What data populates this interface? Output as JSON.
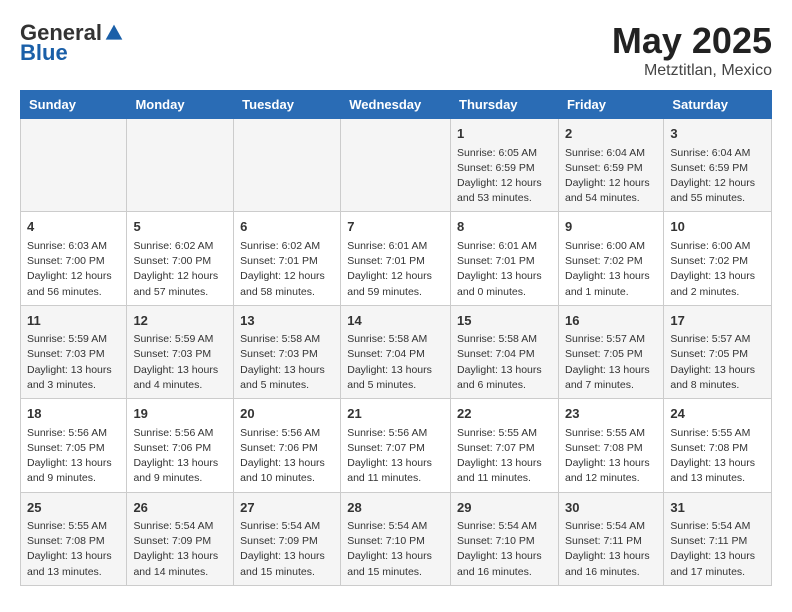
{
  "header": {
    "logo_general": "General",
    "logo_blue": "Blue",
    "month_title": "May 2025",
    "location": "Metztitlan, Mexico"
  },
  "days_of_week": [
    "Sunday",
    "Monday",
    "Tuesday",
    "Wednesday",
    "Thursday",
    "Friday",
    "Saturday"
  ],
  "weeks": [
    [
      {
        "day": "",
        "info": ""
      },
      {
        "day": "",
        "info": ""
      },
      {
        "day": "",
        "info": ""
      },
      {
        "day": "",
        "info": ""
      },
      {
        "day": "1",
        "info": "Sunrise: 6:05 AM\nSunset: 6:59 PM\nDaylight: 12 hours and 53 minutes."
      },
      {
        "day": "2",
        "info": "Sunrise: 6:04 AM\nSunset: 6:59 PM\nDaylight: 12 hours and 54 minutes."
      },
      {
        "day": "3",
        "info": "Sunrise: 6:04 AM\nSunset: 6:59 PM\nDaylight: 12 hours and 55 minutes."
      }
    ],
    [
      {
        "day": "4",
        "info": "Sunrise: 6:03 AM\nSunset: 7:00 PM\nDaylight: 12 hours and 56 minutes."
      },
      {
        "day": "5",
        "info": "Sunrise: 6:02 AM\nSunset: 7:00 PM\nDaylight: 12 hours and 57 minutes."
      },
      {
        "day": "6",
        "info": "Sunrise: 6:02 AM\nSunset: 7:01 PM\nDaylight: 12 hours and 58 minutes."
      },
      {
        "day": "7",
        "info": "Sunrise: 6:01 AM\nSunset: 7:01 PM\nDaylight: 12 hours and 59 minutes."
      },
      {
        "day": "8",
        "info": "Sunrise: 6:01 AM\nSunset: 7:01 PM\nDaylight: 13 hours and 0 minutes."
      },
      {
        "day": "9",
        "info": "Sunrise: 6:00 AM\nSunset: 7:02 PM\nDaylight: 13 hours and 1 minute."
      },
      {
        "day": "10",
        "info": "Sunrise: 6:00 AM\nSunset: 7:02 PM\nDaylight: 13 hours and 2 minutes."
      }
    ],
    [
      {
        "day": "11",
        "info": "Sunrise: 5:59 AM\nSunset: 7:03 PM\nDaylight: 13 hours and 3 minutes."
      },
      {
        "day": "12",
        "info": "Sunrise: 5:59 AM\nSunset: 7:03 PM\nDaylight: 13 hours and 4 minutes."
      },
      {
        "day": "13",
        "info": "Sunrise: 5:58 AM\nSunset: 7:03 PM\nDaylight: 13 hours and 5 minutes."
      },
      {
        "day": "14",
        "info": "Sunrise: 5:58 AM\nSunset: 7:04 PM\nDaylight: 13 hours and 5 minutes."
      },
      {
        "day": "15",
        "info": "Sunrise: 5:58 AM\nSunset: 7:04 PM\nDaylight: 13 hours and 6 minutes."
      },
      {
        "day": "16",
        "info": "Sunrise: 5:57 AM\nSunset: 7:05 PM\nDaylight: 13 hours and 7 minutes."
      },
      {
        "day": "17",
        "info": "Sunrise: 5:57 AM\nSunset: 7:05 PM\nDaylight: 13 hours and 8 minutes."
      }
    ],
    [
      {
        "day": "18",
        "info": "Sunrise: 5:56 AM\nSunset: 7:05 PM\nDaylight: 13 hours and 9 minutes."
      },
      {
        "day": "19",
        "info": "Sunrise: 5:56 AM\nSunset: 7:06 PM\nDaylight: 13 hours and 9 minutes."
      },
      {
        "day": "20",
        "info": "Sunrise: 5:56 AM\nSunset: 7:06 PM\nDaylight: 13 hours and 10 minutes."
      },
      {
        "day": "21",
        "info": "Sunrise: 5:56 AM\nSunset: 7:07 PM\nDaylight: 13 hours and 11 minutes."
      },
      {
        "day": "22",
        "info": "Sunrise: 5:55 AM\nSunset: 7:07 PM\nDaylight: 13 hours and 11 minutes."
      },
      {
        "day": "23",
        "info": "Sunrise: 5:55 AM\nSunset: 7:08 PM\nDaylight: 13 hours and 12 minutes."
      },
      {
        "day": "24",
        "info": "Sunrise: 5:55 AM\nSunset: 7:08 PM\nDaylight: 13 hours and 13 minutes."
      }
    ],
    [
      {
        "day": "25",
        "info": "Sunrise: 5:55 AM\nSunset: 7:08 PM\nDaylight: 13 hours and 13 minutes."
      },
      {
        "day": "26",
        "info": "Sunrise: 5:54 AM\nSunset: 7:09 PM\nDaylight: 13 hours and 14 minutes."
      },
      {
        "day": "27",
        "info": "Sunrise: 5:54 AM\nSunset: 7:09 PM\nDaylight: 13 hours and 15 minutes."
      },
      {
        "day": "28",
        "info": "Sunrise: 5:54 AM\nSunset: 7:10 PM\nDaylight: 13 hours and 15 minutes."
      },
      {
        "day": "29",
        "info": "Sunrise: 5:54 AM\nSunset: 7:10 PM\nDaylight: 13 hours and 16 minutes."
      },
      {
        "day": "30",
        "info": "Sunrise: 5:54 AM\nSunset: 7:11 PM\nDaylight: 13 hours and 16 minutes."
      },
      {
        "day": "31",
        "info": "Sunrise: 5:54 AM\nSunset: 7:11 PM\nDaylight: 13 hours and 17 minutes."
      }
    ]
  ]
}
